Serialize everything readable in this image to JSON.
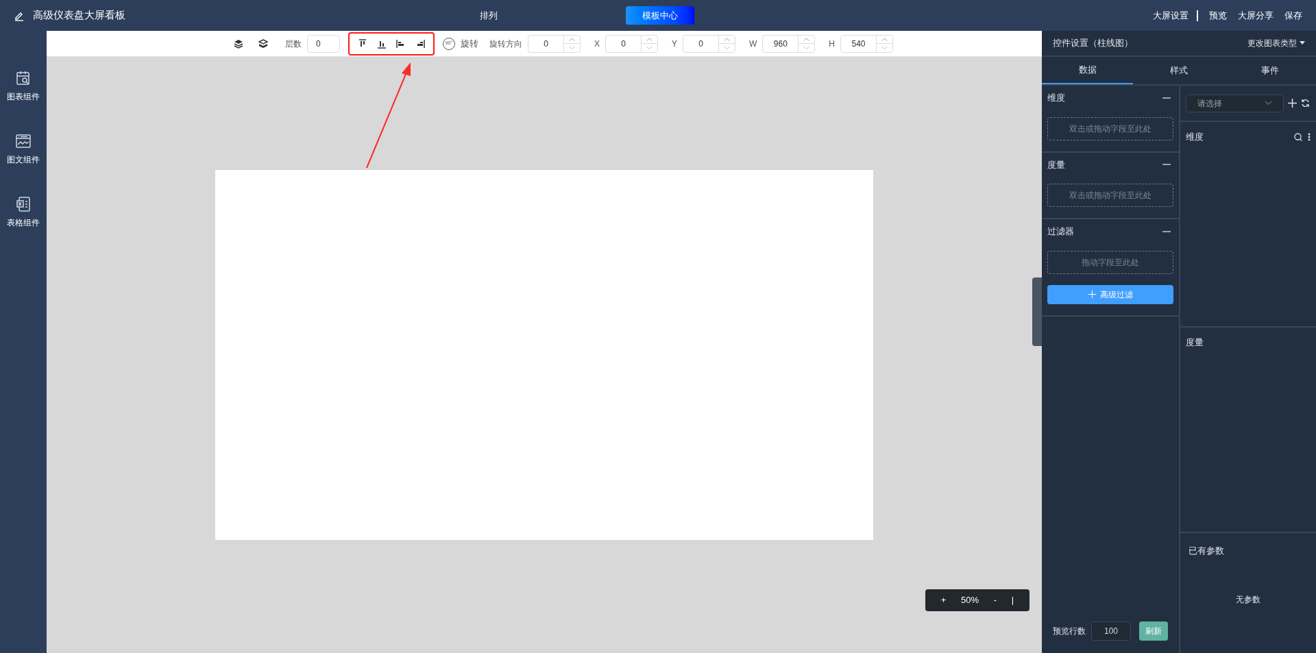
{
  "app": {
    "title": "高级仪表盘大屏看板"
  },
  "top_nav": [
    {
      "label": "排列",
      "selected": false
    },
    {
      "label": "模板中心",
      "selected": true
    }
  ],
  "top_actions": [
    {
      "label": "大屏设置",
      "kind": "link"
    },
    {
      "label": "预览",
      "kind": "link"
    },
    {
      "label": "大屏分享",
      "kind": "link"
    },
    {
      "label": "保存",
      "kind": "link"
    }
  ],
  "sidebar": {
    "items": [
      {
        "label": "图表组件",
        "kind": "chart"
      },
      {
        "label": "图文组件",
        "kind": "media"
      },
      {
        "label": "表格组件",
        "kind": "table"
      }
    ]
  },
  "toolbar": {
    "layer": {
      "label": "层数",
      "value": "0"
    },
    "rotate": {
      "icon_label": "90°",
      "label": "旋转"
    },
    "fields": [
      {
        "label": "旋转方向",
        "value": "0"
      },
      {
        "label": "X",
        "value": "0"
      },
      {
        "label": "Y",
        "value": "0"
      },
      {
        "label": "W",
        "value": "960"
      },
      {
        "label": "H",
        "value": "540"
      }
    ]
  },
  "zoom": {
    "plus": "+",
    "value": "50%",
    "minus": "-",
    "bar": "|"
  },
  "panel": {
    "title": "控件设置（柱线图）",
    "change_type": "更改图表类型",
    "tabs": [
      {
        "label": "数据",
        "selected": true
      },
      {
        "label": "样式",
        "selected": false
      },
      {
        "label": "事件",
        "selected": false
      }
    ],
    "sections": [
      {
        "title": "维度",
        "drop_hint": "双击或拖动字段至此处"
      },
      {
        "title": "度量",
        "drop_hint": "双击或拖动字段至此处"
      },
      {
        "title": "过滤器",
        "drop_hint": "拖动字段至此处",
        "button": "高级过滤"
      }
    ],
    "preview_rows": {
      "label": "预览行数",
      "value": "100",
      "button": "刷新"
    },
    "select": {
      "placeholder": "请选择"
    },
    "fields_dimension": "维度",
    "fields_measure": "度量",
    "params": {
      "title": "已有参数",
      "empty": "无参数"
    }
  }
}
